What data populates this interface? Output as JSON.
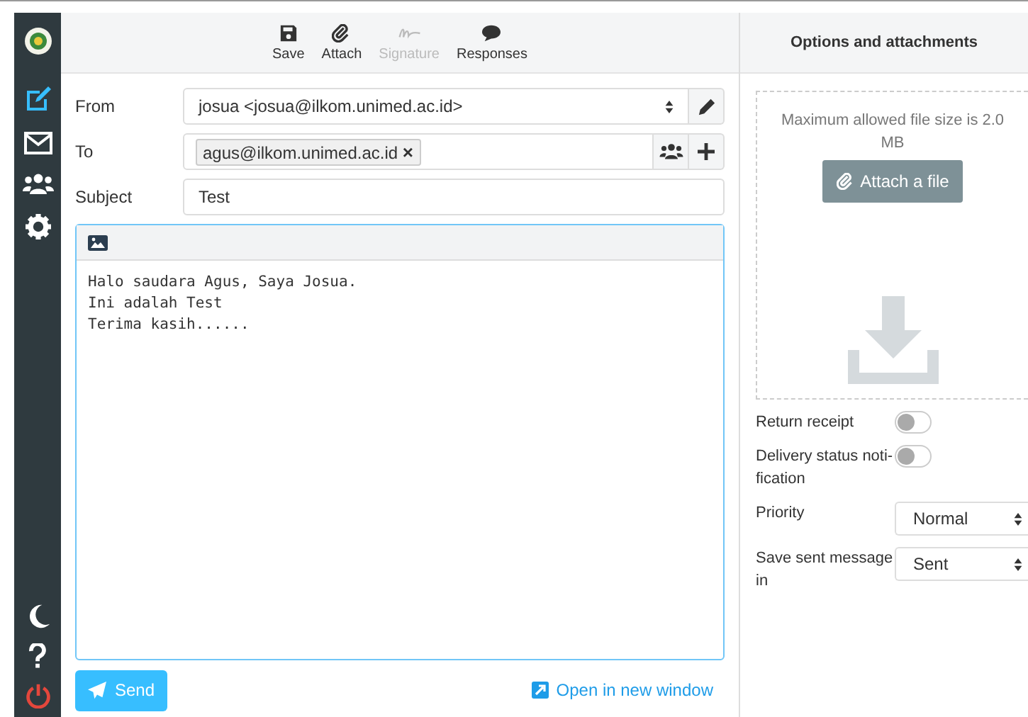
{
  "sidebar": {
    "top": [
      {
        "kind": "compose",
        "selected": true
      },
      {
        "kind": "mail",
        "selected": false
      },
      {
        "kind": "contacts",
        "selected": false
      },
      {
        "kind": "settings",
        "selected": false
      }
    ],
    "bottom": [
      {
        "kind": "moon"
      },
      {
        "kind": "help"
      },
      {
        "kind": "power"
      }
    ]
  },
  "toolbar": [
    {
      "kind": "save",
      "label": "Save",
      "disabled": false
    },
    {
      "kind": "attach",
      "label": "Attach",
      "disabled": false
    },
    {
      "kind": "signature",
      "label": "Signature",
      "disabled": true
    },
    {
      "kind": "responses",
      "label": "Responses",
      "disabled": false
    }
  ],
  "form": {
    "from": {
      "label": "From",
      "value": "josua <josua@ilkom.unimed.ac.id>"
    },
    "to": {
      "label": "To",
      "recipients": [
        "agus@ilkom.unimed.ac.id"
      ],
      "remove_glyph": "×"
    },
    "subject": {
      "label": "Subject",
      "value": "Test"
    }
  },
  "editor": {
    "lines": [
      "Halo saudara Agus, Saya Josua.",
      "Ini adalah Test",
      "Terima kasih......"
    ]
  },
  "footer": {
    "send": "Send",
    "open_new_window": "Open in new window"
  },
  "options": {
    "title": "Options and attachments",
    "max_size_note": "Maximum allowed file size is 2.0 MB",
    "attach_button": "Attach a file",
    "toggles": [
      {
        "label": "Return receipt",
        "on": false
      },
      {
        "label": "Delivery status noti-fication",
        "on": false
      }
    ],
    "selects": [
      {
        "label": "Priority",
        "value": "Normal"
      },
      {
        "label": "Save sent message in",
        "value": "Sent"
      }
    ]
  }
}
